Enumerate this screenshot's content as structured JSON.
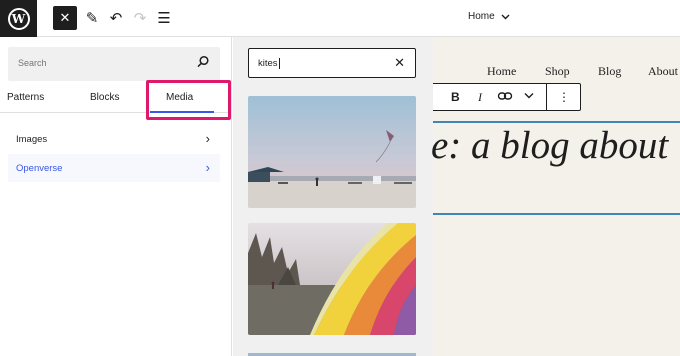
{
  "toolbar": {
    "logo": "W",
    "close_icon": "✕",
    "pen_icon": "✎",
    "undo_icon": "↶",
    "redo_icon": "↷",
    "list_icon": "☰",
    "document_title": "Home",
    "document_chevron": "⌄"
  },
  "sidebar": {
    "search_placeholder": "Search",
    "tabs": [
      {
        "label": "Patterns"
      },
      {
        "label": "Blocks"
      },
      {
        "label": "Media",
        "active": true
      }
    ],
    "categories": [
      {
        "label": "Images",
        "arrow": "›"
      },
      {
        "label": "Openverse",
        "arrow": "›",
        "selected": true
      }
    ]
  },
  "media": {
    "search_value": "kites",
    "clear_icon": "✕",
    "results": [
      {
        "icon": "beach-kite-photo"
      },
      {
        "icon": "rainbow-kite-photo"
      },
      {
        "icon": "partial-photo"
      }
    ]
  },
  "canvas": {
    "nav": [
      "Home",
      "Shop",
      "Blog",
      "About"
    ],
    "block_toolbar": {
      "bold": "B",
      "italic": "I",
      "link_icon": "link-icon",
      "more": "⌄",
      "options": "⋮"
    },
    "heading_text": "e: a blog about"
  },
  "colors": {
    "accent": "#3858e9",
    "highlight": "#e0186c",
    "canvas_bg": "#f4f1ea",
    "block_border": "#3f86b6"
  }
}
